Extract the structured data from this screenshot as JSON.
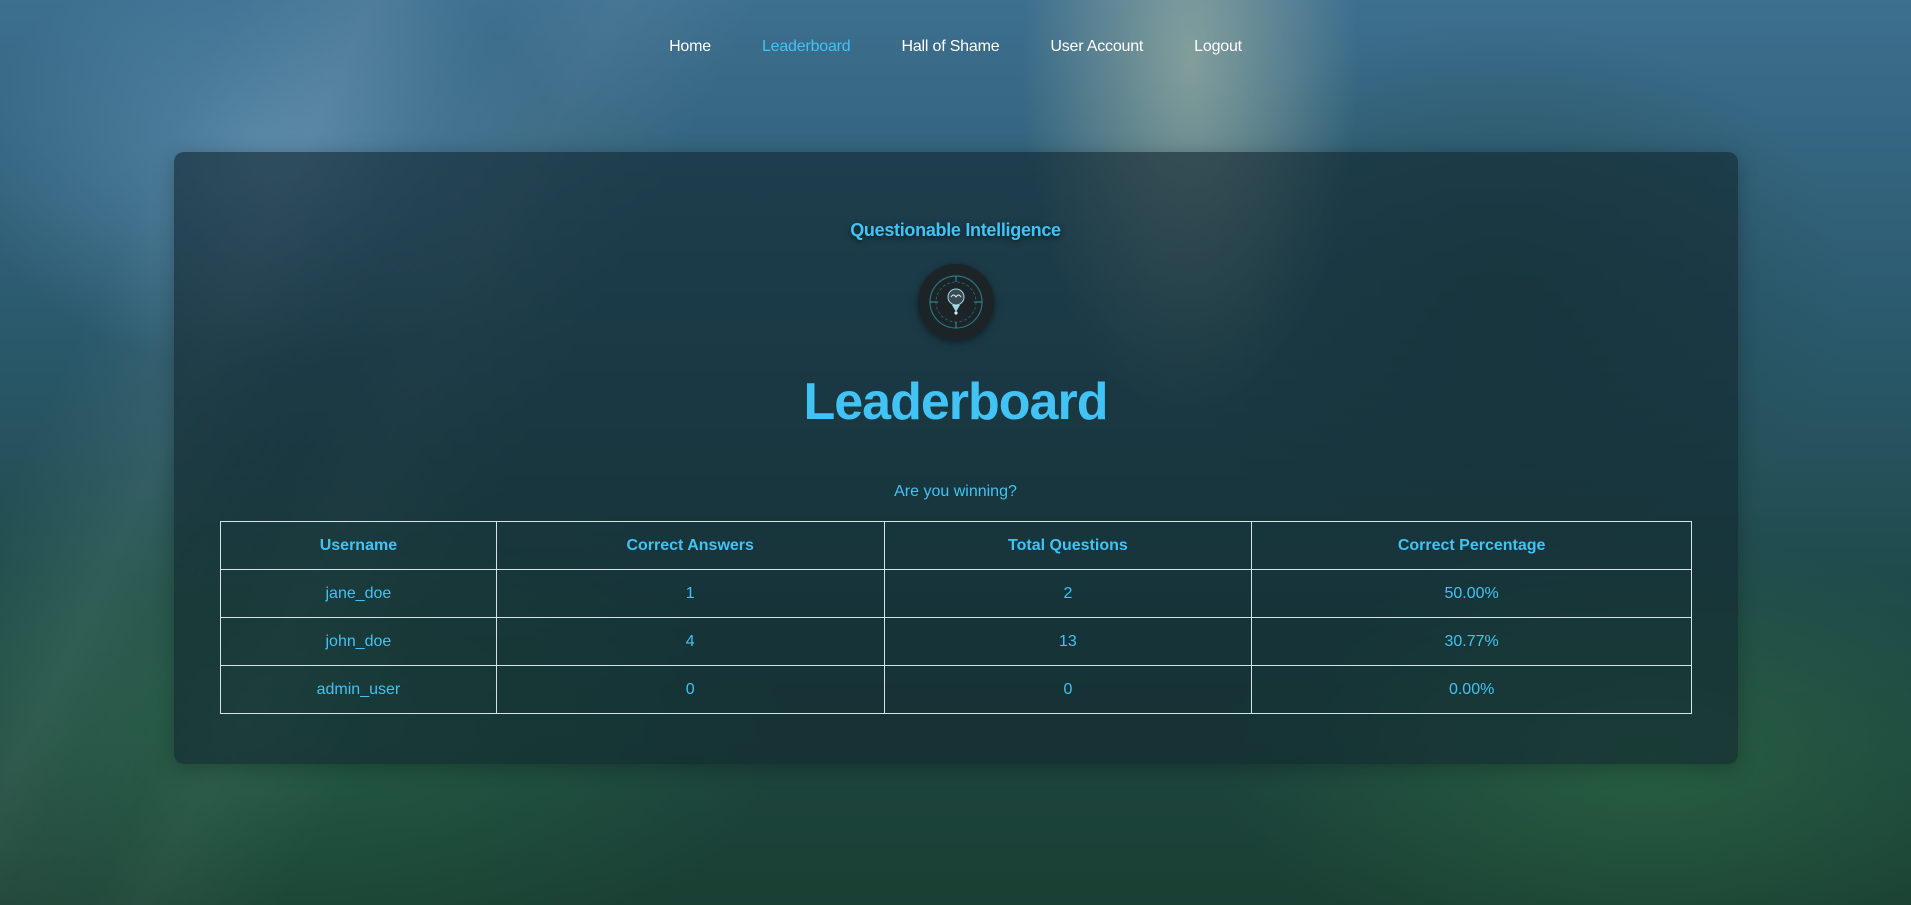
{
  "nav": {
    "items": [
      {
        "label": "Home",
        "active": false
      },
      {
        "label": "Leaderboard",
        "active": true
      },
      {
        "label": "Hall of Shame",
        "active": false
      },
      {
        "label": "User Account",
        "active": false
      },
      {
        "label": "Logout",
        "active": false
      }
    ]
  },
  "brand": {
    "name": "Questionable Intelligence",
    "logo_icon": "brain-circuit-logo-icon"
  },
  "page": {
    "title": "Leaderboard",
    "subtitle": "Are you winning?"
  },
  "leaderboard": {
    "columns": [
      "Username",
      "Correct Answers",
      "Total Questions",
      "Correct Percentage"
    ],
    "rows": [
      [
        "jane_doe",
        "1",
        "2",
        "50.00%"
      ],
      [
        "john_doe",
        "4",
        "13",
        "30.77%"
      ],
      [
        "admin_user",
        "0",
        "0",
        "0.00%"
      ]
    ]
  },
  "colors": {
    "accent": "#41c3f5",
    "panel": "#11262e",
    "nav_text": "#ffffff",
    "table_border": "#d6e3e8"
  }
}
